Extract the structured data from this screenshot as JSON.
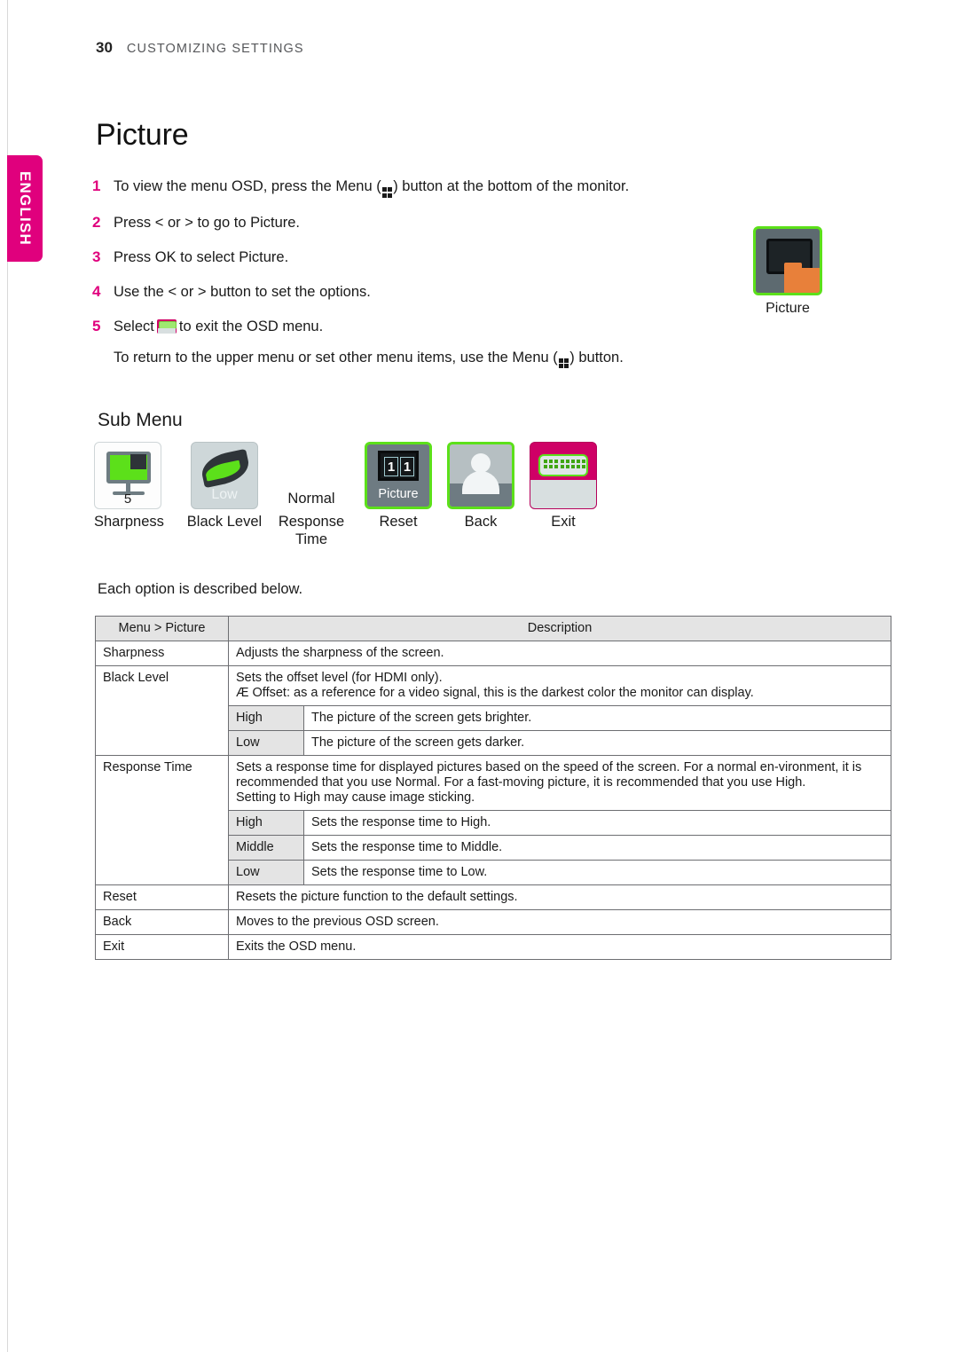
{
  "page": {
    "number": "30",
    "running_title": "CUSTOMIZING SETTINGS",
    "language_tab": "ENGLISH",
    "heading": "Picture"
  },
  "colors": {
    "accent_magenta": "#e0007d",
    "accent_green": "#5ce01a",
    "exit_magenta": "#cf0066",
    "folder_orange": "#e8803a"
  },
  "steps": [
    {
      "num": "1",
      "text_before": "To view the menu OSD, press the Menu (",
      "icon": "menu-grid-icon",
      "text_after": ") button at the bottom of the monitor."
    },
    {
      "num": "2",
      "text_before": "Press < or > to go to Picture.",
      "icon": "",
      "text_after": ""
    },
    {
      "num": "3",
      "text_before": "Press OK to select Picture.",
      "icon": "",
      "text_after": ""
    },
    {
      "num": "4",
      "text_before": "Use the < or > button to set the options.",
      "icon": "",
      "text_after": ""
    },
    {
      "num": "5",
      "text_before": "Select",
      "icon": "exit-icon",
      "text_after": "to exit the OSD menu."
    }
  ],
  "step_note": {
    "text_before": "To return to the upper menu or set other menu items, use the Menu (",
    "icon": "menu-grid-icon",
    "text_after": ") button."
  },
  "picture_card": {
    "label": "Picture"
  },
  "submenu": {
    "heading": "Sub Menu",
    "items": [
      {
        "label": "Sharpness",
        "value": "5",
        "icon": "monitor-sharpness-icon"
      },
      {
        "label": "Black Level",
        "value": "Low",
        "icon": "leaf-black-level-icon"
      },
      {
        "label": "Response\nTime",
        "value": "Normal",
        "icon": ""
      },
      {
        "label": "Reset",
        "value": "Picture",
        "icon": "reset-panel-icon"
      },
      {
        "label": "Back",
        "value": "",
        "icon": "person-back-icon"
      },
      {
        "label": "Exit",
        "value": "",
        "icon": "connector-exit-icon"
      }
    ],
    "labels": {
      "sharpness": "Sharpness",
      "black_level": "Black Level",
      "response_time_1": "Response",
      "response_time_2": "Time",
      "reset": "Reset",
      "back": "Back",
      "exit": "Exit"
    },
    "values": {
      "sharpness": "5",
      "black_level": "Low",
      "response_time": "Normal",
      "reset": "Picture"
    }
  },
  "intro_line": "Each option is described below.",
  "table": {
    "headers": {
      "menu": "Menu > Picture",
      "description": "Description"
    },
    "rows": [
      {
        "kind": "simple",
        "name": "Sharpness",
        "desc": "Adjusts the sharpness of the screen."
      },
      {
        "kind": "group",
        "name": "Black Level",
        "desc_lines": [
          "Sets the offset level (for HDMI only).",
          "Æ Offset: as a reference for a video signal, this is the darkest color the monitor can display."
        ],
        "options": [
          {
            "opt": "High",
            "desc": "The picture of the screen gets brighter."
          },
          {
            "opt": "Low",
            "desc": "The picture of the screen gets darker."
          }
        ]
      },
      {
        "kind": "group",
        "name": "Response Time",
        "desc_lines": [
          "Sets a response time for displayed pictures based on the speed of the screen. For a normal en-vironment, it is recommended that you use Normal. For a fast-moving picture, it is recommended that you use High.",
          "Setting to High may cause image sticking."
        ],
        "options": [
          {
            "opt": "High",
            "desc": "Sets the response time to High."
          },
          {
            "opt": "Middle",
            "desc": "Sets the response time to Middle."
          },
          {
            "opt": "Low",
            "desc": "Sets the response time to Low."
          }
        ]
      },
      {
        "kind": "simple",
        "name": "Reset",
        "desc": "Resets the picture function to the default settings."
      },
      {
        "kind": "simple",
        "name": "Back",
        "desc": "Moves to the previous OSD screen."
      },
      {
        "kind": "simple",
        "name": "Exit",
        "desc": "Exits the OSD menu."
      }
    ]
  }
}
